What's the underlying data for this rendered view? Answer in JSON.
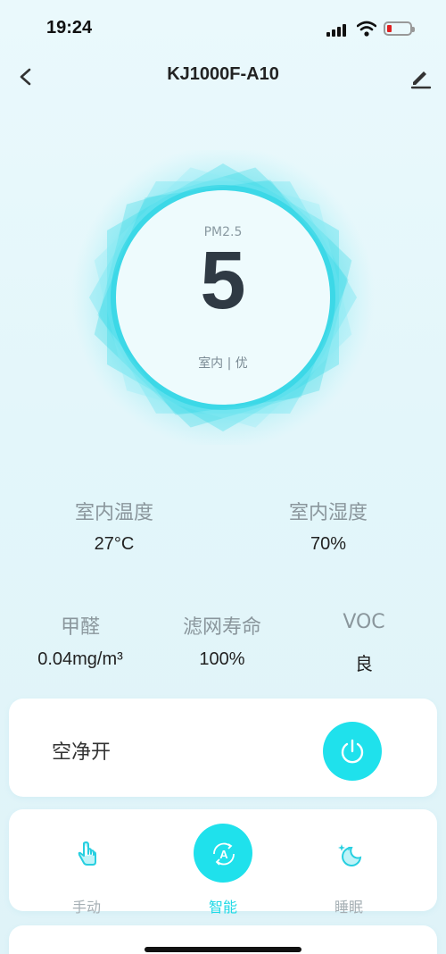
{
  "status": {
    "time": "19:24",
    "signal_icon": "signal-bars-icon",
    "wifi_icon": "wifi-icon",
    "battery_icon": "battery-low-icon",
    "battery_color": "#e02020"
  },
  "nav": {
    "title": "KJ1000F-A10",
    "back_icon": "chevron-left-icon",
    "edit_icon": "pencil-icon"
  },
  "air": {
    "pm_label": "PM2.5",
    "pm_value": "5",
    "status": "室内 | 优"
  },
  "metrics": [
    {
      "label": "室内温度",
      "value": "27°C"
    },
    {
      "label": "室内湿度",
      "value": "70%"
    },
    {
      "label": "甲醛",
      "value": "0.04mg/m³"
    },
    {
      "label": "滤网寿命",
      "value": "100%"
    },
    {
      "label": "VOC",
      "value": "良"
    }
  ],
  "power": {
    "label": "空净开",
    "state": "on",
    "icon": "power-icon",
    "color": "#1fe1ec"
  },
  "modes": [
    {
      "label": "手动",
      "icon": "hand-pointer-icon",
      "active": false
    },
    {
      "label": "智能",
      "icon": "auto-mode-icon",
      "active": true
    },
    {
      "label": "睡眠",
      "icon": "moon-sleep-icon",
      "active": false
    }
  ],
  "colors": {
    "accent": "#1fe1ec",
    "background": "#e3f6fa",
    "text_primary": "#222222",
    "text_secondary": "#8a969c"
  }
}
